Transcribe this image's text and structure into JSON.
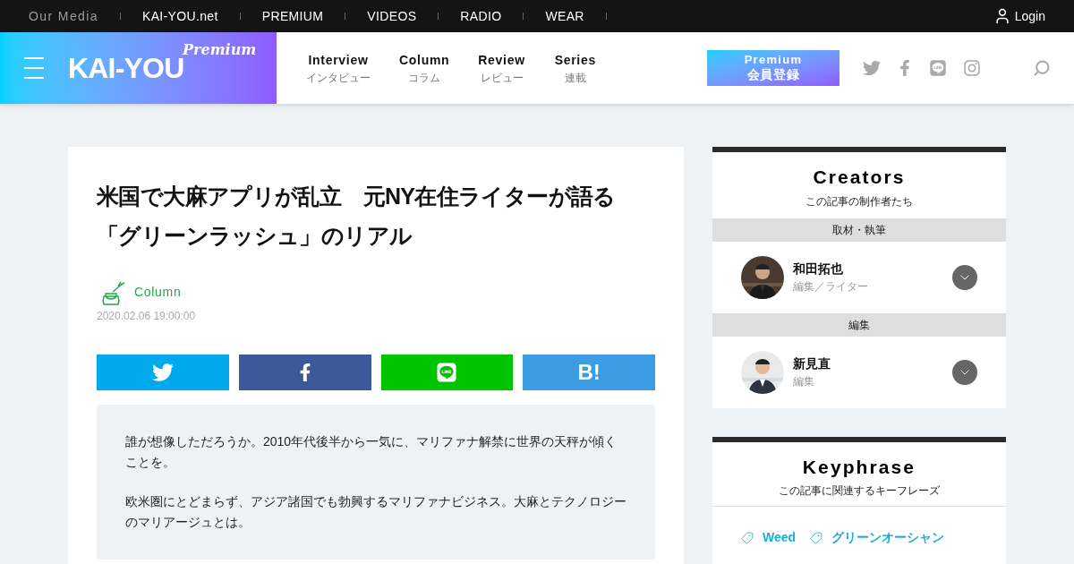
{
  "top_bar": {
    "label": "Our Media",
    "links": [
      "KAI-YOU.net",
      "PREMIUM",
      "VIDEOS",
      "RADIO",
      "WEAR"
    ],
    "login": "Login"
  },
  "header": {
    "logo": "KAI-YOU",
    "logo_badge": "Premium",
    "nav": [
      {
        "label": "Interview",
        "sub": "インタビュー"
      },
      {
        "label": "Column",
        "sub": "コラム"
      },
      {
        "label": "Review",
        "sub": "レビュー"
      },
      {
        "label": "Series",
        "sub": "連載"
      }
    ],
    "signup": {
      "line1": "Premium",
      "line2": "会員登録"
    }
  },
  "article": {
    "title": "米国で大麻アプリが乱立　元NY在住ライターが語る「グリーンラッシュ」のリアル",
    "category": "Column",
    "date": "2020.02.06 19:00:00",
    "share": [
      {
        "kind": "twitter",
        "color": "#00a9ec"
      },
      {
        "kind": "facebook",
        "color": "#3b5998"
      },
      {
        "kind": "line",
        "color": "#00c300"
      },
      {
        "kind": "hatena",
        "color": "#3c9ce4",
        "text": "B!"
      }
    ],
    "lead": [
      "誰が想像しただろうか。2010年代後半から一気に、マリファナ解禁に世界の天秤が傾くことを。",
      "欧米圏にとどまらず、アジア諸国でも勃興するマリファナビジネス。大麻とテクノロジーのマリアージュとは。"
    ]
  },
  "creators": {
    "title": "Creators",
    "subtitle": "この記事の制作者たち",
    "groups": [
      {
        "role": "取材・執筆",
        "name": "和田拓也",
        "position": "編集／ライター"
      },
      {
        "role": "編集",
        "name": "新見直",
        "position": "編集"
      }
    ]
  },
  "keyphrase": {
    "title": "Keyphrase",
    "subtitle": "この記事に関連するキーフレーズ",
    "tags": [
      "Weed",
      "グリーンオーシャン"
    ]
  }
}
